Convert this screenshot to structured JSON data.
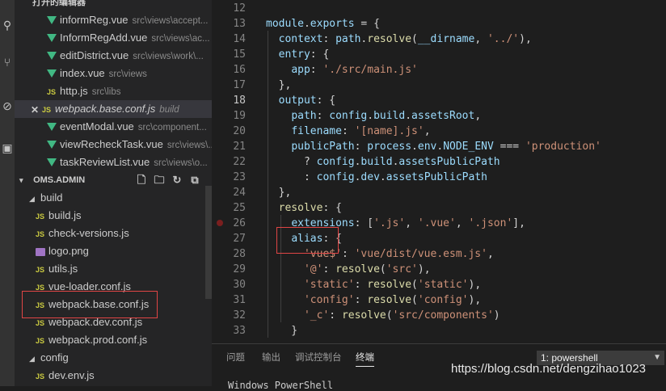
{
  "open_editors": {
    "header": "打开的编辑器",
    "items": [
      {
        "type": "vue",
        "name": "informReg.vue",
        "desc": "src\\views\\accept..."
      },
      {
        "type": "vue",
        "name": "InformRegAdd.vue",
        "desc": "src\\views\\ac..."
      },
      {
        "type": "vue",
        "name": "editDistrict.vue",
        "desc": "src\\views\\work\\..."
      },
      {
        "type": "vue",
        "name": "index.vue",
        "desc": "src\\views"
      },
      {
        "type": "js",
        "name": "http.js",
        "desc": "src\\libs"
      },
      {
        "type": "js",
        "name": "webpack.base.conf.js",
        "desc": "build",
        "active": true
      },
      {
        "type": "vue",
        "name": "eventModal.vue",
        "desc": "src\\component..."
      },
      {
        "type": "vue",
        "name": "viewRecheckTask.vue",
        "desc": "src\\views\\..."
      },
      {
        "type": "vue",
        "name": "taskReviewList.vue",
        "desc": "src\\views\\o..."
      }
    ]
  },
  "explorer": {
    "header": "OMS.ADMIN",
    "actions": [
      "new-file-icon",
      "new-folder-icon",
      "refresh-icon",
      "collapse-icon"
    ],
    "build_folder": "build",
    "build_files": [
      {
        "type": "js",
        "name": "build.js"
      },
      {
        "type": "js",
        "name": "check-versions.js"
      },
      {
        "type": "img",
        "name": "logo.png"
      },
      {
        "type": "js",
        "name": "utils.js"
      },
      {
        "type": "js",
        "name": "vue-loader.conf.js"
      },
      {
        "type": "js",
        "name": "webpack.base.conf.js"
      },
      {
        "type": "js",
        "name": "webpack.dev.conf.js"
      },
      {
        "type": "js",
        "name": "webpack.prod.conf.js"
      }
    ],
    "config_folder": "config",
    "config_files": [
      {
        "type": "js",
        "name": "dev.env.js"
      }
    ]
  },
  "editor": {
    "lines": [
      {
        "n": "12",
        "code": ""
      },
      {
        "n": "13",
        "code": "module.exports = {"
      },
      {
        "n": "14",
        "code": "  context: path.resolve(__dirname, '../'),"
      },
      {
        "n": "15",
        "code": "  entry: {"
      },
      {
        "n": "16",
        "code": "    app: './src/main.js'"
      },
      {
        "n": "17",
        "code": "  },"
      },
      {
        "n": "18",
        "code": "  output: {"
      },
      {
        "n": "19",
        "code": "    path: config.build.assetsRoot,"
      },
      {
        "n": "20",
        "code": "    filename: '[name].js',"
      },
      {
        "n": "21",
        "code": "    publicPath: process.env.NODE_ENV === 'production'"
      },
      {
        "n": "22",
        "code": "      ? config.build.assetsPublicPath"
      },
      {
        "n": "23",
        "code": "      : config.dev.assetsPublicPath"
      },
      {
        "n": "24",
        "code": "  },"
      },
      {
        "n": "25",
        "code": "  resolve: {"
      },
      {
        "n": "26",
        "code": "    extensions: ['.js', '.vue', '.json'],"
      },
      {
        "n": "27",
        "code": "    alias: {"
      },
      {
        "n": "28",
        "code": "      'vue$': 'vue/dist/vue.esm.js',"
      },
      {
        "n": "29",
        "code": "      '@': resolve('src'),"
      },
      {
        "n": "30",
        "code": "      'static': resolve('static'),"
      },
      {
        "n": "31",
        "code": "      'config': resolve('config'),"
      },
      {
        "n": "32",
        "code": "      '_c': resolve('src/components')"
      },
      {
        "n": "33",
        "code": "    }"
      }
    ]
  },
  "panel": {
    "tabs": [
      "问题",
      "输出",
      "调试控制台",
      "终端"
    ],
    "active_tab": 3,
    "terminal_select": "1: powershell",
    "terminal_text": "Windows PowerShell"
  },
  "watermark": "https://blog.csdn.net/dengzihao1023",
  "colors": {
    "highlight_box": "#e04545",
    "vue": "#41b883",
    "js": "#cbcb41",
    "string": "#ce9178",
    "property": "#9cdcfe",
    "function": "#dcdcaa"
  }
}
